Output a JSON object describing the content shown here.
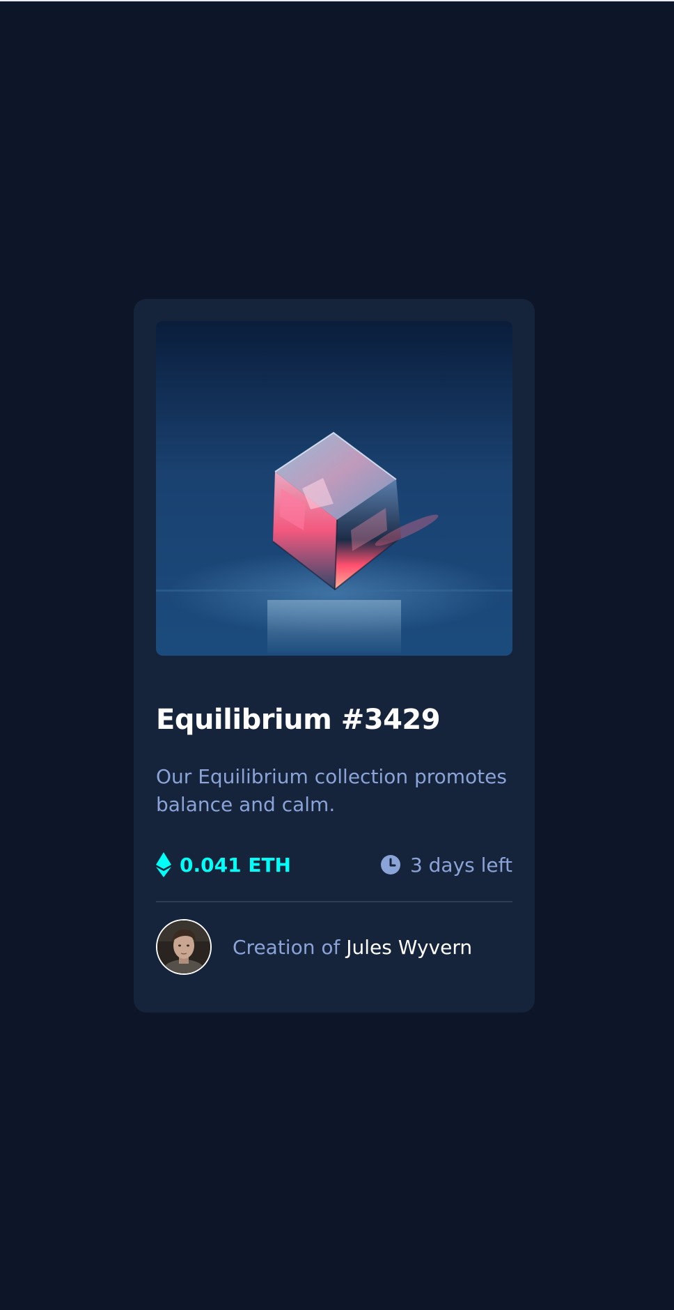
{
  "nft": {
    "title": "Equilibrium #3429",
    "description": "Our Equilibrium collection promotes balance and calm.",
    "price": "0.041 ETH",
    "time_left": "3 days left",
    "creator_prefix": "Creation of",
    "creator_name": "Jules Wyvern"
  },
  "icons": {
    "price": "ethereum-icon",
    "time": "clock-icon"
  },
  "colors": {
    "page_bg": "#0d1629",
    "card_bg": "#15233b",
    "accent_cyan": "#00fff8",
    "soft_blue": "#8ba4d8",
    "white": "#ffffff",
    "divider": "#2f3e57"
  }
}
